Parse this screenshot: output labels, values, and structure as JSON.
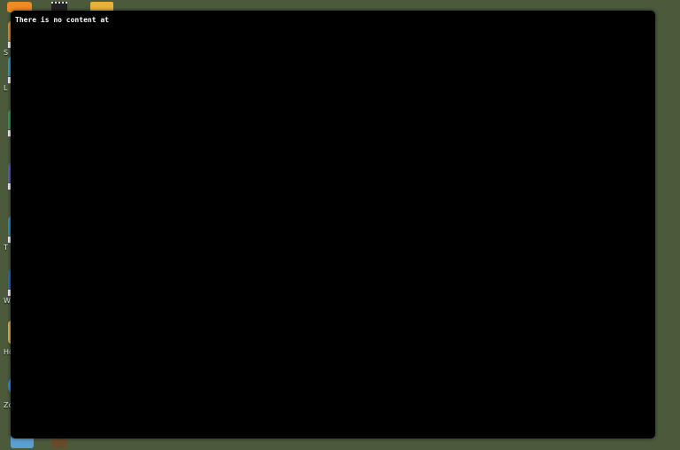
{
  "desktop": {
    "background_color": "#4a5a3a",
    "icons": [
      {
        "name": "screenshot-app-icon",
        "label": "S",
        "color": "#f08a24"
      },
      {
        "name": "app-icon-2",
        "label": "L",
        "color": "#2aa0d8"
      },
      {
        "name": "app-icon-3",
        "label": "",
        "color": "#2ea44f"
      },
      {
        "name": "app-icon-4",
        "label": "",
        "color": "#5b5bd6"
      },
      {
        "name": "app-icon-5",
        "label": "T",
        "color": "#2a8fd0"
      },
      {
        "name": "app-icon-6",
        "label": "W",
        "color": "#1e6fd9"
      },
      {
        "name": "folder-icon",
        "label": "Ho",
        "color": "#e8b23a"
      },
      {
        "name": "zoom-icon",
        "label": "Zoo",
        "color": "#2d8cff"
      }
    ]
  },
  "terminal": {
    "background_color": "#000000",
    "text_color": "#ffffff",
    "output_text": "There is no content at"
  }
}
